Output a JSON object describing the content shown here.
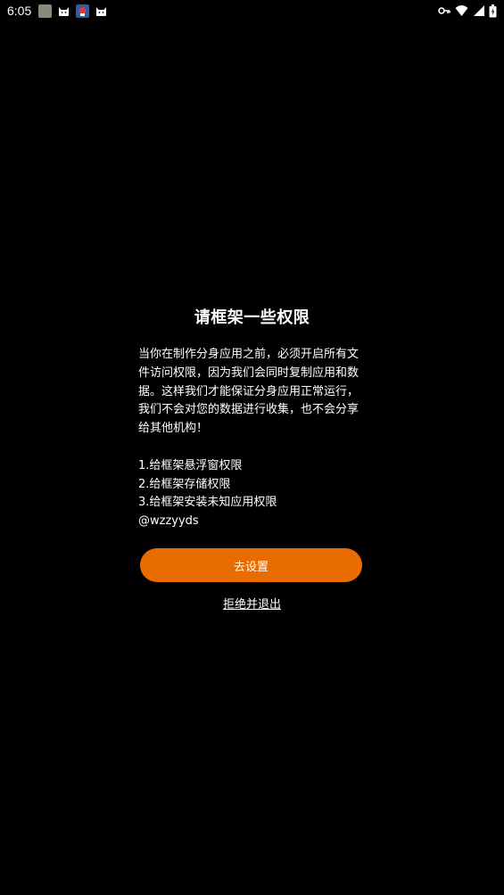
{
  "status_bar": {
    "time": "6:05",
    "left_icons": [
      "image-thumbnail-icon",
      "cat-app-icon",
      "game-app-icon",
      "cat-app-icon"
    ],
    "right_icons": [
      "key-icon",
      "wifi-icon",
      "signal-icon",
      "battery-icon"
    ]
  },
  "dialog": {
    "title": "请框架一些权限",
    "body": "当你在制作分身应用之前，必须开启所有文件访问权限，因为我们会同时复制应用和数据。这样我们才能保证分身应用正常运行，我们不会对您的数据进行收集，也不会分享给其他机构！\n\n1.给框架悬浮窗权限\n2.给框架存储权限\n3.给框架安装未知应用权限\n@wzzyyds",
    "primary_button": "去设置",
    "secondary_link": "拒绝并退出"
  },
  "colors": {
    "background": "#000000",
    "accent": "#e86c00",
    "text": "#ffffff"
  }
}
